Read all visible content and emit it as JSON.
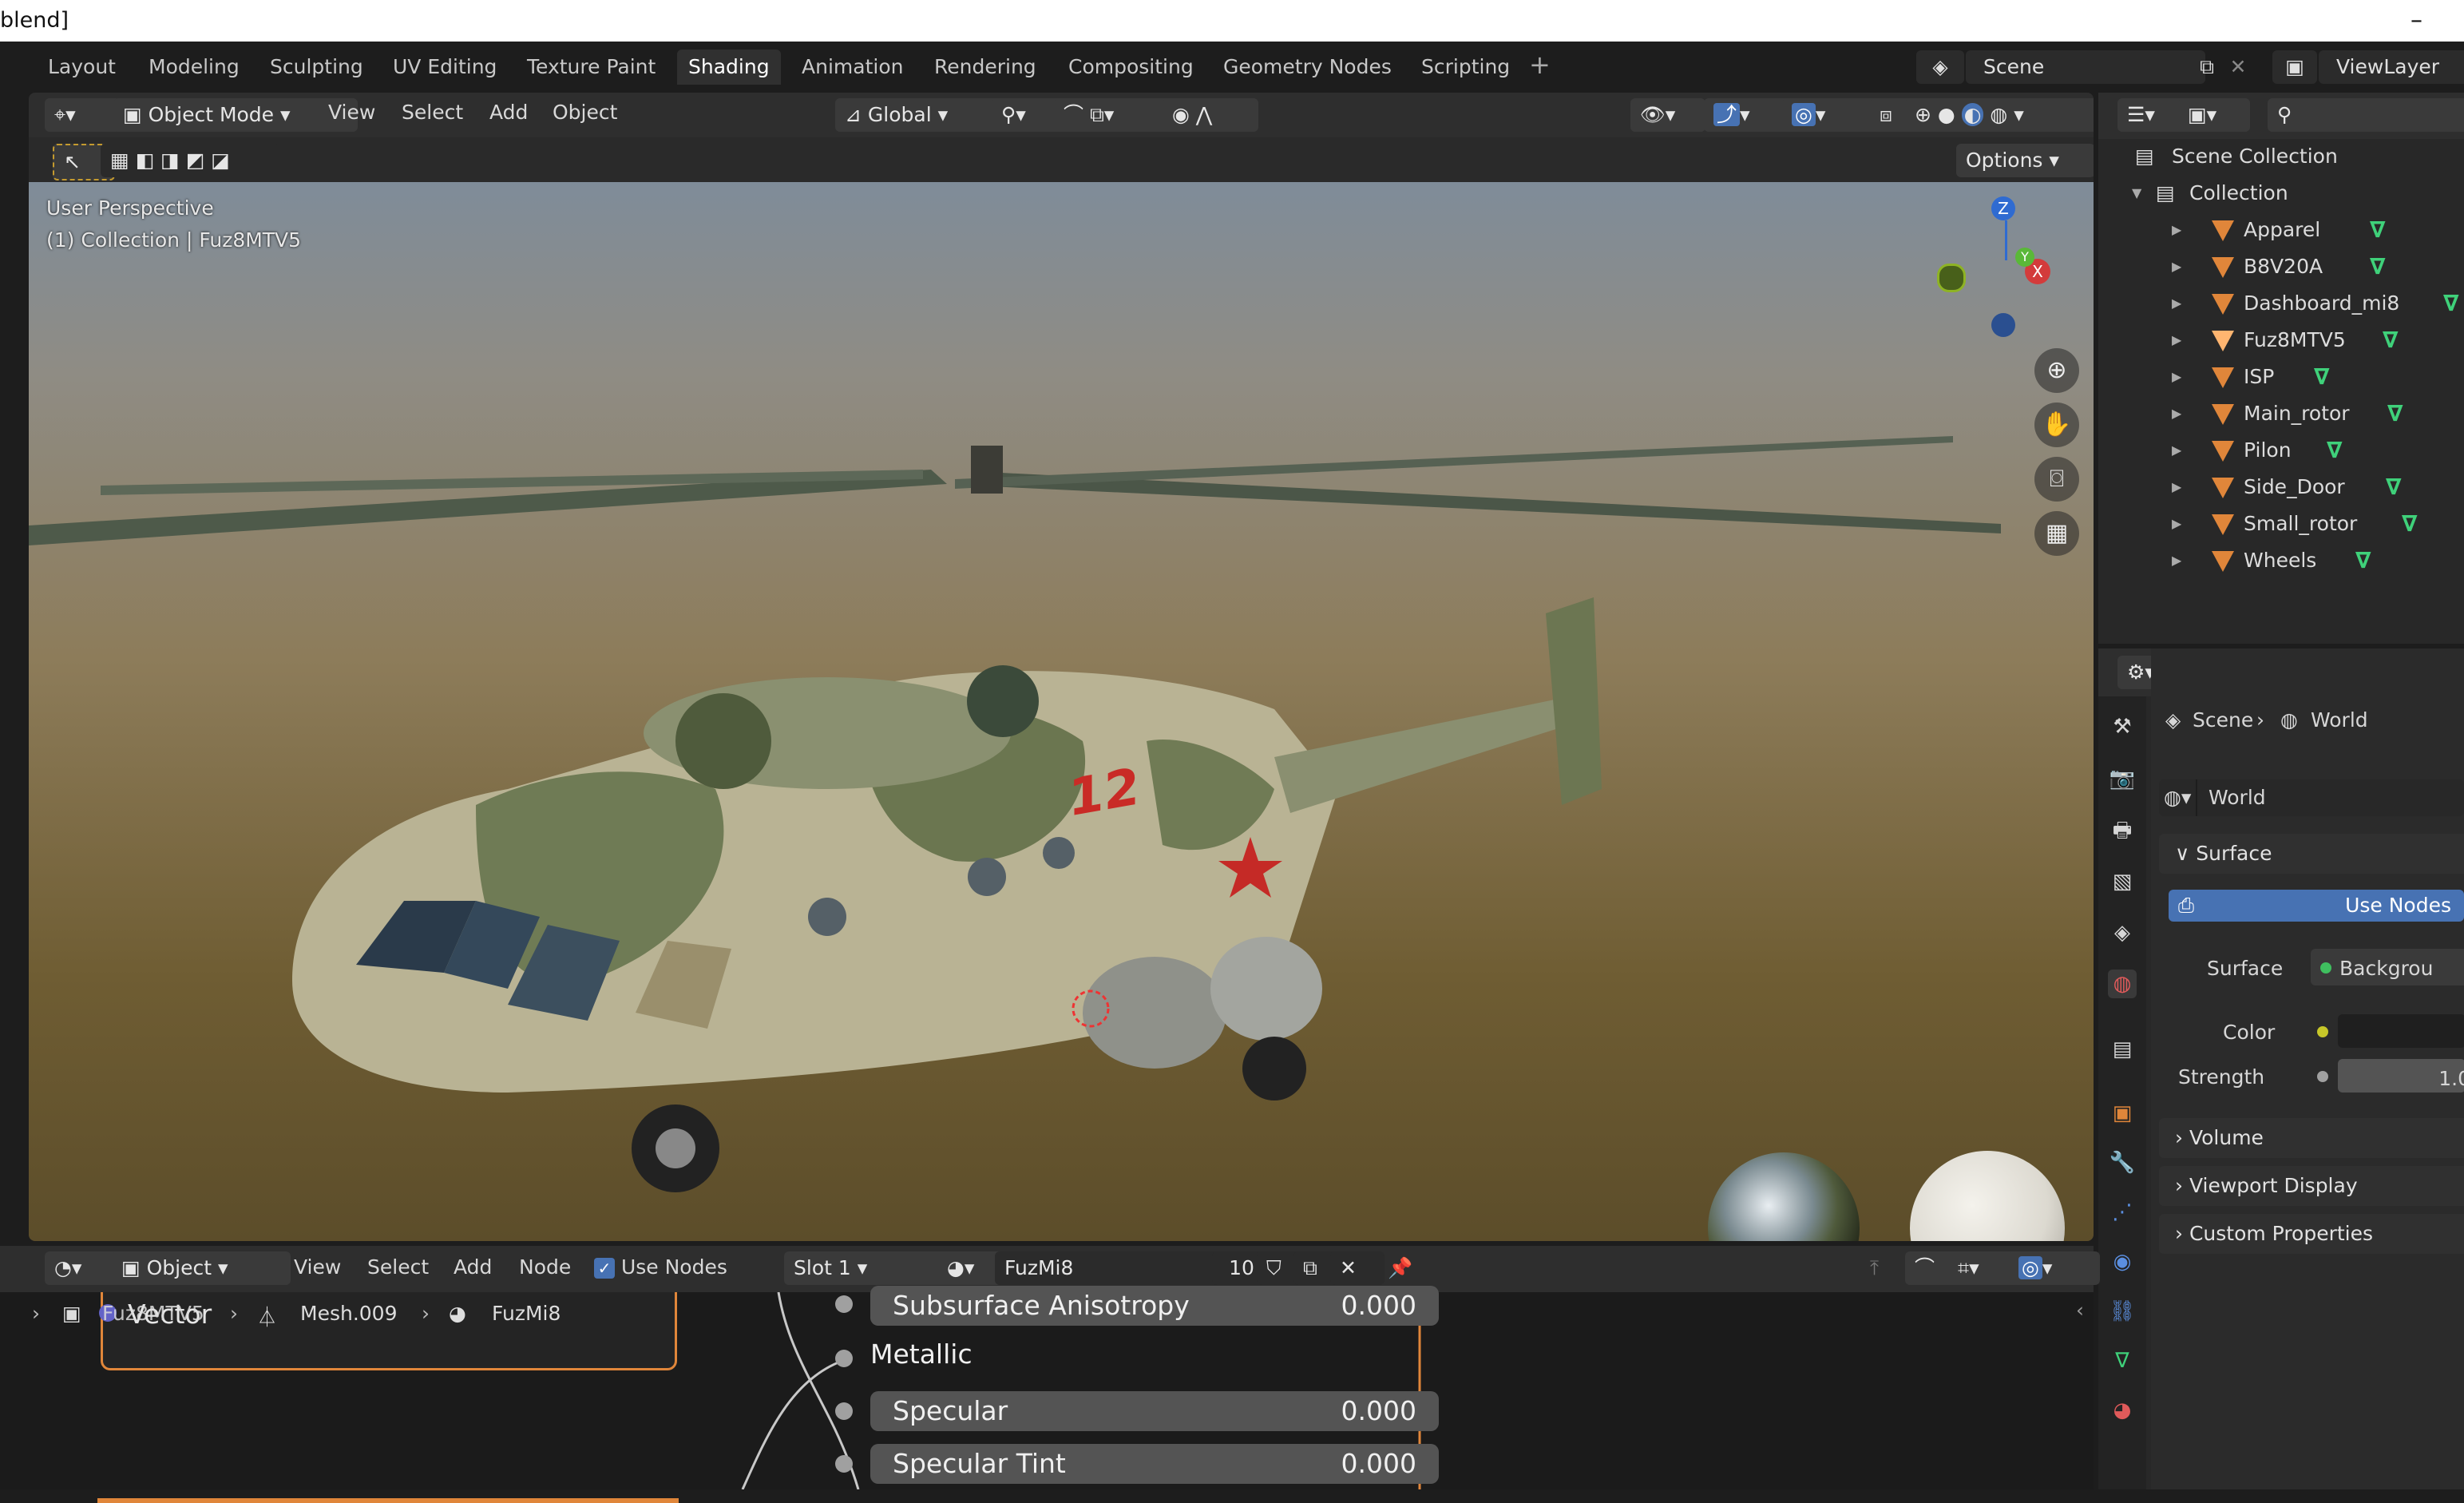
{
  "window": {
    "title": "blend]",
    "minimize": "–"
  },
  "workspace_tabs": [
    "Layout",
    "Modeling",
    "Sculpting",
    "UV Editing",
    "Texture Paint",
    "Shading",
    "Animation",
    "Rendering",
    "Compositing",
    "Geometry Nodes",
    "Scripting"
  ],
  "active_tab": "Shading",
  "scene": {
    "name": "Scene",
    "view_layer": "ViewLayer"
  },
  "viewport": {
    "mode": "Object Mode",
    "menus": [
      "View",
      "Select",
      "Add",
      "Object"
    ],
    "orientation": "Global",
    "options": "Options",
    "overlay_line1": "User Perspective",
    "overlay_line2": "(1) Collection | Fuz8MTV5",
    "gizmo_z": "Z",
    "gizmo_x": "X",
    "gizmo_y": "Y",
    "aircraft_number": "12"
  },
  "outliner": {
    "root": "Scene Collection",
    "collection": "Collection",
    "items": [
      "Apparel",
      "B8V20A",
      "Dashboard_mi8",
      "Fuz8MTV5",
      "ISP",
      "Main_rotor",
      "Pilon",
      "Side_Door",
      "Small_rotor",
      "Wheels"
    ]
  },
  "properties": {
    "breadcrumb_scene": "Scene",
    "breadcrumb_world": "World",
    "world_name": "World",
    "surface_panel": "Surface",
    "use_nodes": "Use Nodes",
    "surface_label": "Surface",
    "surface_value": "Backgrou",
    "color_label": "Color",
    "strength_label": "Strength",
    "strength_value": "1.0",
    "volume_panel": "Volume",
    "viewport_display_panel": "Viewport Display",
    "custom_props_panel": "Custom Properties",
    "colors": {
      "use_nodes_bg": "#4772b3",
      "yellow_socket": "#c7c729",
      "green_socket": "#3fbf5f"
    }
  },
  "node_editor": {
    "type": "Object",
    "menus": [
      "View",
      "Select",
      "Add",
      "Node"
    ],
    "use_nodes": "Use Nodes",
    "slot": "Slot 1",
    "material": "FuzMi8",
    "users": "10",
    "breadcrumb": {
      "object": "Fuz8MTV5",
      "mesh": "Mesh.009",
      "material": "FuzMi8"
    },
    "vector_label": "Vector",
    "rows": [
      {
        "label": "Subsurface Anisotropy",
        "value": "0.000"
      },
      {
        "label": "Metallic",
        "value": ""
      },
      {
        "label": "Specular",
        "value": "0.000"
      },
      {
        "label": "Specular Tint",
        "value": "0.000"
      }
    ]
  }
}
